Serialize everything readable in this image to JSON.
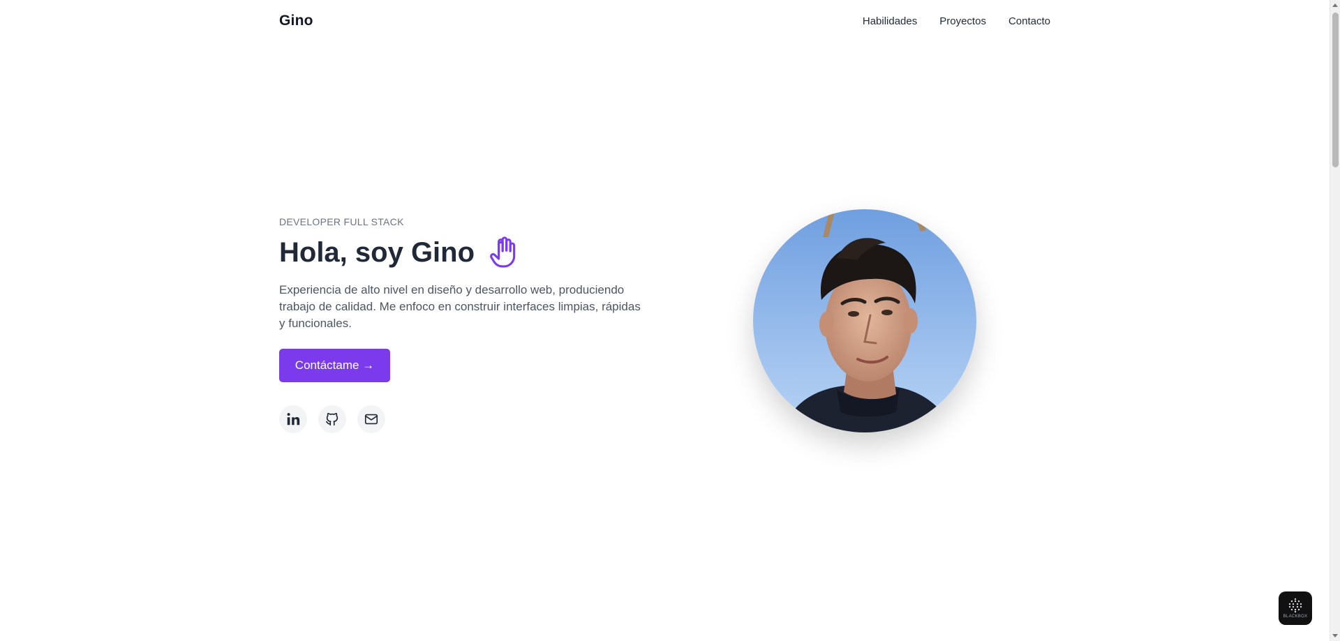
{
  "header": {
    "logo": "Gino",
    "nav": [
      {
        "label": "Habilidades"
      },
      {
        "label": "Proyectos"
      },
      {
        "label": "Contacto"
      }
    ]
  },
  "hero": {
    "eyebrow": "DEVELOPER FULL STACK",
    "title": "Hola, soy Gino",
    "title_icon": "raised-hand-icon",
    "description": "Experiencia de alto nivel en diseño y desarrollo web, produciendo trabajo de calidad. Me enfoco en construir interfaces limpias, rápidas y funcionales.",
    "cta_label": "Contáctame →",
    "socials": [
      {
        "icon": "linkedin-icon"
      },
      {
        "icon": "github-icon"
      },
      {
        "icon": "mail-icon"
      }
    ],
    "avatar_icon": "profile-photo"
  },
  "widget": {
    "label": "BLACKBOX"
  },
  "colors": {
    "accent": "#7c3aed",
    "text": "#1f2937",
    "muted": "#6b7280",
    "social_bg": "#f3f4f6"
  }
}
